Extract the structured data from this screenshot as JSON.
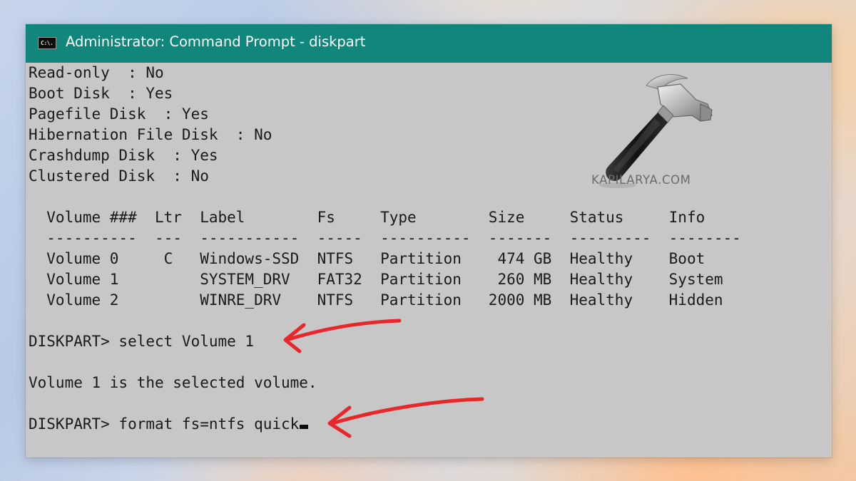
{
  "window": {
    "title": "Administrator: Command Prompt - diskpart",
    "icon": "cmd-icon",
    "icon_text": "C:\\."
  },
  "console": {
    "disk_attributes": [
      "Read-only  : No",
      "Boot Disk  : Yes",
      "Pagefile Disk  : Yes",
      "Hibernation File Disk  : No",
      "Crashdump Disk  : Yes",
      "Clustered Disk  : No"
    ],
    "volume_table_header": "  Volume ###  Ltr  Label        Fs     Type        Size     Status     Info",
    "volume_table_separator": "  ----------  ---  -----------  -----  ----------  -------  ---------  --------",
    "volume_rows": [
      "  Volume 0     C   Windows-SSD  NTFS   Partition    474 GB  Healthy    Boot",
      "  Volume 1         SYSTEM_DRV   FAT32  Partition    260 MB  Healthy    System",
      "  Volume 2         WINRE_DRV    NTFS   Partition   2000 MB  Healthy    Hidden"
    ],
    "command_1": "DISKPART> select Volume 1",
    "response_1": "Volume 1 is the selected volume.",
    "command_2": "DISKPART> format fs=ntfs quick"
  },
  "watermark": {
    "text": "KAPILARYA.COM",
    "icon": "hammer-icon"
  },
  "annotations": {
    "arrow_color": "#e8272b",
    "arrow_count": 2
  },
  "colors": {
    "titlebar": "#11877b",
    "console_background": "#c7c7c7",
    "console_text": "#1a1a1a"
  }
}
